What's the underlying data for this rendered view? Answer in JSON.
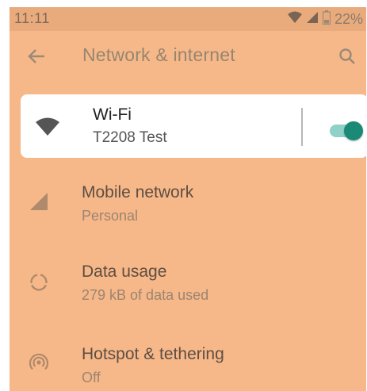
{
  "status_bar": {
    "time": "11:11",
    "battery": "22%"
  },
  "app_bar": {
    "title": "Network & internet"
  },
  "wifi": {
    "title": "Wi-Fi",
    "network": "T2208 Test",
    "enabled": true
  },
  "items": [
    {
      "title": "Mobile network",
      "subtitle": "Personal",
      "icon": "signal-icon"
    },
    {
      "title": "Data usage",
      "subtitle": "279 kB of data used",
      "icon": "data-usage-icon"
    },
    {
      "title": "Hotspot & tethering",
      "subtitle": "Off",
      "icon": "hotspot-icon"
    }
  ],
  "colors": {
    "background": "#f6b889",
    "status_bar": "#e9ab7c",
    "toggle_on": "#1a8a76",
    "toggle_track": "#8fd1c9"
  }
}
